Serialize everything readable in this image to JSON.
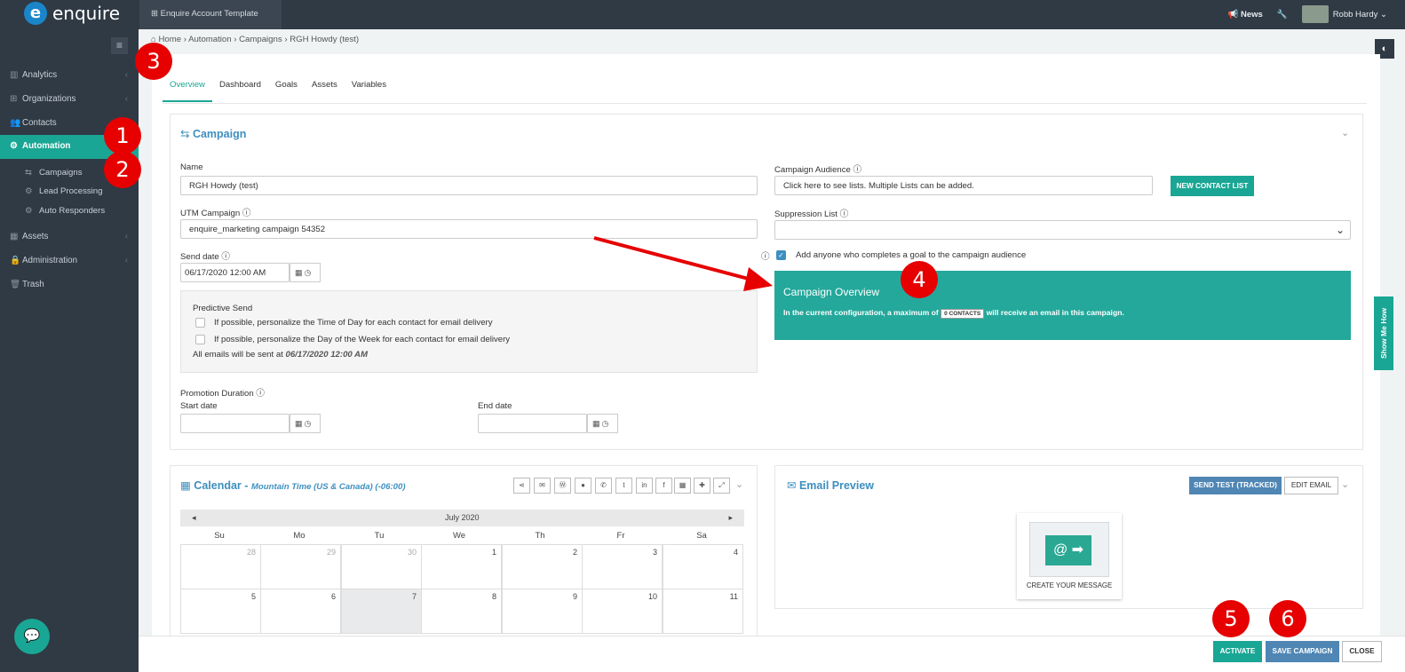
{
  "app": {
    "brand": "enquire",
    "account_tab": "Enquire Account Template",
    "news": "News",
    "user": "Robb Hardy"
  },
  "sidebar": {
    "items": [
      {
        "label": "Analytics",
        "icon": "chart-icon"
      },
      {
        "label": "Organizations",
        "icon": "sitemap-icon"
      },
      {
        "label": "Contacts",
        "icon": "users-icon"
      },
      {
        "label": "Automation",
        "icon": "gears-icon"
      },
      {
        "label": "Assets",
        "icon": "grid-icon"
      },
      {
        "label": "Administration",
        "icon": "lock-icon"
      },
      {
        "label": "Trash",
        "icon": "trash-icon"
      }
    ],
    "sub": [
      "Campaigns",
      "Lead Processing",
      "Auto Responders"
    ]
  },
  "breadcrumb": {
    "home": "Home",
    "automation": "Automation",
    "campaigns": "Campaigns",
    "current": "RGH Howdy (test)"
  },
  "tabs": [
    "Overview",
    "Dashboard",
    "Goals",
    "Assets",
    "Variables"
  ],
  "campaign": {
    "title": "Campaign",
    "name_label": "Name",
    "name_value": "RGH Howdy (test)",
    "utm_label": "UTM Campaign",
    "utm_value": "enquire_marketing campaign 54352",
    "send_label": "Send date",
    "send_value": "06/17/2020 12:00 AM",
    "predictive_title": "Predictive Send",
    "predictive_opt1": "If possible, personalize the Time of Day for each contact for email delivery",
    "predictive_opt2": "If possible, personalize the Day of the Week for each contact for email delivery",
    "all_emails_prefix": "All emails will be sent at",
    "all_emails_time": "06/17/2020 12:00 AM",
    "promo_label": "Promotion Duration",
    "start_label": "Start date",
    "end_label": "End date",
    "audience_label": "Campaign Audience",
    "audience_placeholder": "Click here to see lists. Multiple Lists can be added.",
    "new_list_btn": "NEW CONTACT LIST",
    "suppression_label": "Suppression List",
    "goal_check_label": "Add anyone who completes a goal to the campaign audience",
    "overview_title": "Campaign Overview",
    "overview_text_pre": "In the current configuration, a maximum of",
    "overview_badge": "0 CONTACTS",
    "overview_text_post": "will receive an email in this campaign."
  },
  "calendar": {
    "title": "Calendar -",
    "timezone": "Mountain Time (US & Canada) (-06:00)",
    "month": "July 2020",
    "days": [
      "Su",
      "Mo",
      "Tu",
      "We",
      "Th",
      "Fr",
      "Sa"
    ],
    "week1": [
      "28",
      "29",
      "30",
      "1",
      "2",
      "3",
      "4"
    ],
    "week2": [
      "5",
      "6",
      "7",
      "8",
      "9",
      "10",
      "11"
    ]
  },
  "email": {
    "title": "Email Preview",
    "send_test": "SEND TEST (TRACKED)",
    "edit": "EDIT EMAIL",
    "create": "CREATE YOUR MESSAGE"
  },
  "footer": {
    "activate": "ACTIVATE",
    "save": "SAVE CAMPAIGN",
    "close": "CLOSE"
  },
  "show_me": "Show Me How",
  "markers": [
    "1",
    "2",
    "3",
    "4",
    "5",
    "6"
  ],
  "colors": {
    "teal": "#1aa694",
    "nav": "#2f3a45",
    "blue": "#3d8fbf",
    "red": "#e60000"
  }
}
